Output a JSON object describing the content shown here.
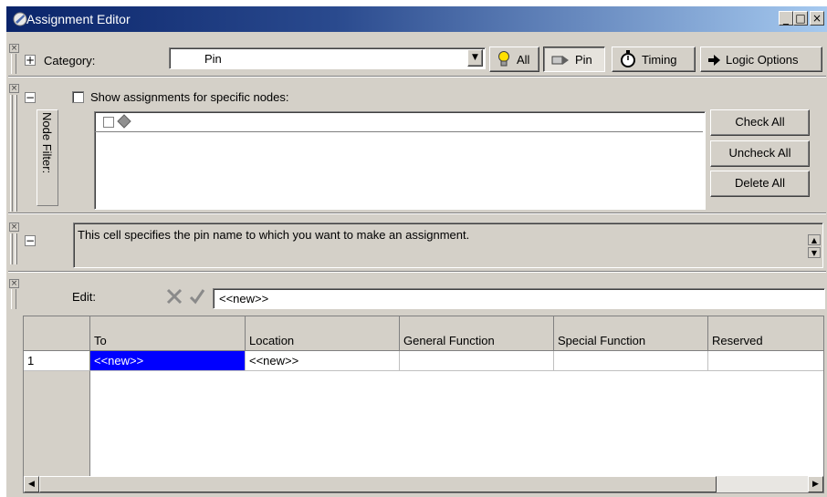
{
  "window": {
    "title": "Assignment Editor",
    "controls": [
      "_",
      "□",
      "×"
    ]
  },
  "toolbar": {
    "category_label": "Category:",
    "category_value": "Pin",
    "buttons": [
      {
        "label": "All",
        "icon": "bulb-icon"
      },
      {
        "label": "Pin",
        "icon": "pin-icon",
        "pressed": true
      },
      {
        "label": "Timing",
        "icon": "stopwatch-icon"
      },
      {
        "label": "Logic Options",
        "icon": "arrow-icon"
      }
    ]
  },
  "node_filter": {
    "side_label": "Node Filter:",
    "show_label": "Show assignments for specific nodes:",
    "buttons": {
      "check_all": "Check All",
      "uncheck_all": "Uncheck All",
      "delete_all": "Delete All"
    }
  },
  "info": {
    "text": "This cell specifies the pin name to which you want to make an assignment."
  },
  "edit": {
    "label": "Edit:",
    "value": "<<new>>"
  },
  "table": {
    "columns": [
      "To",
      "Location",
      "General Function",
      "Special Function",
      "Reserved"
    ],
    "rows": [
      {
        "num": "1",
        "cells": [
          "<<new>>",
          "<<new>>",
          "",
          "",
          ""
        ]
      }
    ]
  },
  "colors": {
    "selection": "#0000ff",
    "face": "#d4d0c8",
    "title_start": "#0a246a",
    "title_end": "#a6caf0"
  }
}
